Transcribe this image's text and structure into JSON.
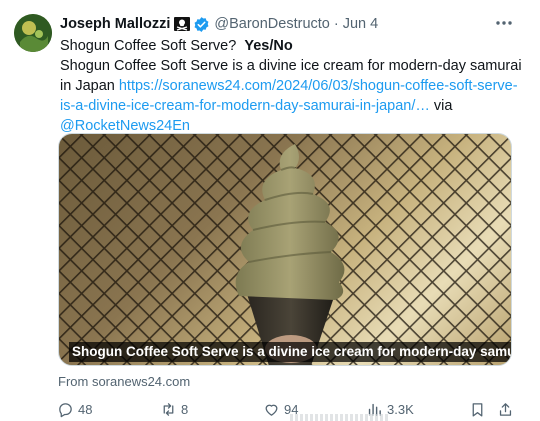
{
  "tweet": {
    "author_name": "Joseph Mallozzi",
    "handle": "@BaronDestructo",
    "separator": "·",
    "date": "Jun 4",
    "text": {
      "line1_plain": "Shogun Coffee Soft Serve?",
      "line1_bold": "Yes/No",
      "line2_plain": "Shogun Coffee Soft Serve is a divine ice cream for modern-day samurai in Japan",
      "link_text": "https://soranews24.com/2024/06/03/shogun-coffee-soft-serve-is-a-divine-ice-cream-for-modern-day-samurai-in-japan/…",
      "via_text": "via",
      "mention": "@RocketNews24En"
    },
    "media": {
      "caption": "Shogun Coffee Soft Serve is a divine ice cream for modern-day samurai in..."
    },
    "source": "From soranews24.com",
    "actions": {
      "replies": "48",
      "reposts": "8",
      "likes": "94",
      "views": "3.3K"
    }
  },
  "icons": {
    "pirate_flag": "pirate-flag-icon",
    "verified": "verified-badge-icon",
    "more": "more-icon",
    "reply": "reply-icon",
    "repost": "repost-icon",
    "like": "like-icon",
    "views": "views-icon",
    "bookmark": "bookmark-icon",
    "share": "share-icon"
  },
  "colors": {
    "text_primary": "#0f1419",
    "text_secondary": "#536471",
    "link": "#1d9bf0",
    "verified": "#1d9bf0"
  }
}
